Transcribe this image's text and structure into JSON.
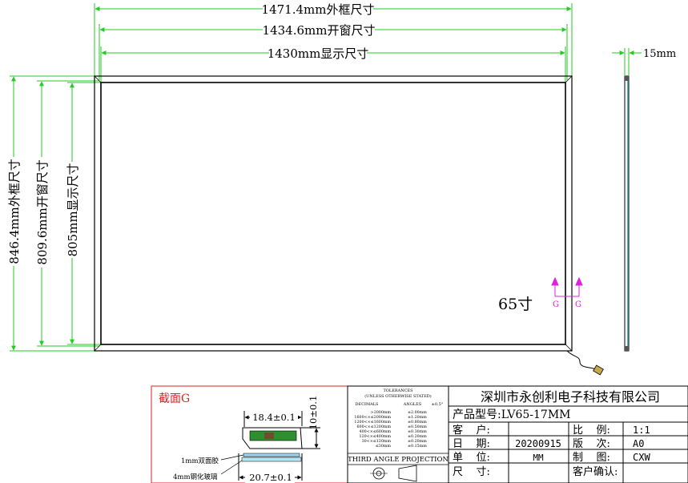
{
  "dimensions": {
    "outer_frame_width": "1471.4mm外框尺寸",
    "window_width": "1434.6mm开窗尺寸",
    "display_width": "1430mm显示尺寸",
    "outer_frame_height": "846.4mm外框尺寸",
    "window_height": "809.6mm开窗尺寸",
    "display_height": "805mm显示尺寸",
    "side_thickness": "15mm"
  },
  "panel": {
    "size_label": "65寸",
    "section_markers": [
      "G",
      "G"
    ]
  },
  "section_detail": {
    "title": "截面G",
    "top_dim": "18.4±0.1",
    "height_dim": "10±0.1",
    "bottom_dim": "20.7±0.1",
    "tape_label": "1mm双面胶",
    "glass_label": "4mm钢化玻璃"
  },
  "tolerances": {
    "header1": "TOLERANCES",
    "header2": "(UNLESS OTHERWISE STATED)",
    "col_decimals": "DECIMALS",
    "col_angles": "ANGLES",
    "angle_tol": "±0.5°",
    "rows": [
      {
        "range": ">2000mm",
        "tol": "±2.00mm"
      },
      {
        "range": "1600<×≤2000mm",
        "tol": "±1.20mm"
      },
      {
        "range": "1200<×≤1600mm",
        "tol": "±0.80mm"
      },
      {
        "range": "600<×≤1200mm",
        "tol": "±0.50mm"
      },
      {
        "range": "400<×≤600mm",
        "tol": "±0.30mm"
      },
      {
        "range": "120<×≤400mm",
        "tol": "±0.20mm"
      },
      {
        "range": "30<×≤120mm",
        "tol": "±0.20mm"
      },
      {
        "range": "≤30mm",
        "tol": "±0.15mm"
      }
    ],
    "projection": "THIRD ANGLE PROJECTION"
  },
  "title_block": {
    "company": "深圳市永创利电子科技有限公司",
    "model_label": "产品型号:LV65-17MM",
    "customer_label": "客    户:",
    "customer_value": "",
    "date_label": "日    期:",
    "date_value": "20200915",
    "unit_label": "单    位:",
    "unit_value": "MM",
    "size_label": "尺    寸:",
    "size_value": "",
    "scale_label": "比    例:",
    "scale_value": "1:1",
    "version_label": "版    次:",
    "version_value": "A0",
    "drawn_label": "制    图:",
    "drawn_value": "CXW",
    "confirm_label": "客户确认:",
    "confirm_value": ""
  },
  "colors": {
    "dimension_line": "#22cc22",
    "marker": "#e020e0",
    "section_title": "#dd2222",
    "side_accent": "#20a0a0"
  }
}
